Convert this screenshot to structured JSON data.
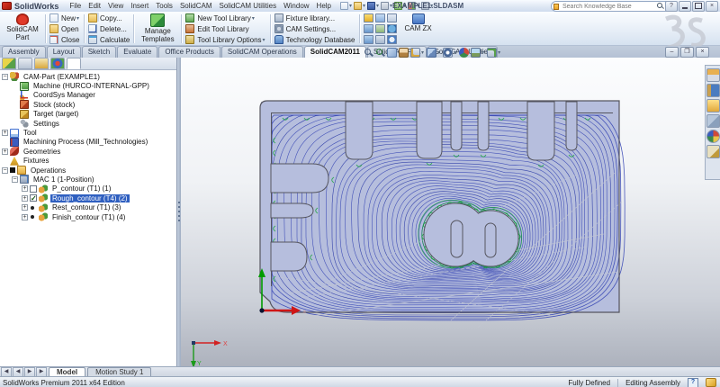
{
  "titlebar": {
    "app_name": "SolidWorks",
    "doc_title": "EXAMPLE1.SLDASM",
    "search_placeholder": "Search Knowledge Base",
    "help_label": "?",
    "menu_items": [
      "File",
      "Edit",
      "View",
      "Insert",
      "Tools",
      "SolidCAM",
      "SolidCAM Utilities",
      "Window",
      "Help"
    ],
    "quick_icons": [
      "new-doc",
      "open-doc",
      "save",
      "print",
      "undo",
      "rebuild",
      "options"
    ]
  },
  "toolbar": {
    "solidcam_part_label": "SolidCAM Part",
    "new_label": "New",
    "open_label": "Open",
    "close_label": "Close",
    "copy_label": "Copy...",
    "delete_label": "Delete...",
    "calculate_label": "Calculate",
    "manage_templates_label": "Manage Templates",
    "new_tool_library_label": "New Tool Library",
    "edit_tool_library_label": "Edit Tool Library",
    "tool_library_options_label": "Tool Library Options",
    "fixture_library_label": "Fixture library...",
    "cam_settings_label": "CAM Settings...",
    "technology_database_label": "Technology Database",
    "cam_zx_label": "CAM ZX"
  },
  "ribbon_tabs": {
    "items": [
      "Assembly",
      "Layout",
      "Sketch",
      "Evaluate",
      "Office Products",
      "SolidCAM Operations",
      "SolidCAM2011",
      "SolidCAM Part",
      "SolidCAM Utilities"
    ],
    "active": "SolidCAM2011"
  },
  "panel_tab_icons": [
    "featuremanager-tab",
    "propertymanager-tab",
    "configurationmanager-tab",
    "appearances-tab",
    "solidcam-manager-tab"
  ],
  "tree": {
    "items": [
      {
        "depth": 0,
        "icon": "campart",
        "label": "CAM-Part (EXAMPLE1)",
        "exp": "minus"
      },
      {
        "depth": 1,
        "icon": "machine",
        "label": "Machine (HURCO-INTERNAL-GPP)"
      },
      {
        "depth": 1,
        "icon": "coordsys",
        "label": "CoordSys Manager"
      },
      {
        "depth": 1,
        "icon": "stock",
        "label": "Stock (stock)"
      },
      {
        "depth": 1,
        "icon": "target",
        "label": "Target (target)"
      },
      {
        "depth": 1,
        "icon": "settings",
        "label": "Settings"
      },
      {
        "depth": 0,
        "icon": "tool",
        "label": "Tool",
        "exp": "plus"
      },
      {
        "depth": 0,
        "icon": "process",
        "label": "Machining Process (Mill_Technologies)"
      },
      {
        "depth": 0,
        "icon": "geometries",
        "label": "Geometries",
        "exp": "plus"
      },
      {
        "depth": 0,
        "icon": "fixtures",
        "label": "Fixtures"
      },
      {
        "depth": 0,
        "icon": "operations",
        "label": "Operations",
        "exp": "minus",
        "square": true
      },
      {
        "depth": 1,
        "icon": "mac",
        "label": "MAC 1 (1-Position)",
        "exp": "minus"
      },
      {
        "depth": 2,
        "icon": "op",
        "label": "P_contour (T1) (1)",
        "exp": "plus",
        "mark": "box"
      },
      {
        "depth": 2,
        "icon": "op",
        "label": "Rough_contour (T4) (2)",
        "exp": "plus",
        "mark": "check",
        "selected": true
      },
      {
        "depth": 2,
        "icon": "op",
        "label": "Rest_contour (T1) (3)",
        "exp": "plus",
        "mark": "dot"
      },
      {
        "depth": 2,
        "icon": "op",
        "label": "Finish_contour (T1) (4)",
        "exp": "plus",
        "mark": "dot"
      }
    ]
  },
  "hud_icons": [
    {
      "name": "zoom-fit",
      "caret": false
    },
    {
      "name": "zoom-area",
      "caret": false
    },
    {
      "name": "previous-view",
      "caret": false
    },
    {
      "name": "section-view",
      "caret": false
    },
    {
      "name": "view-orientation",
      "caret": true
    },
    {
      "name": "display-style",
      "caret": true
    },
    {
      "name": "hide-show",
      "caret": true
    },
    {
      "name": "edit-appearance",
      "caret": false
    },
    {
      "name": "scene",
      "caret": true
    },
    {
      "name": "view-settings",
      "caret": true
    }
  ],
  "taskpane_icons": [
    "home",
    "library",
    "folder",
    "palette",
    "appearance",
    "props"
  ],
  "doc_tabs": {
    "model_label": "Model",
    "motion_label": "Motion Study 1"
  },
  "statusbar": {
    "edition": "SolidWorks Premium 2011 x64 Edition",
    "defined_state": "Fully Defined",
    "mode": "Editing Assembly"
  },
  "viewport": {
    "x_axis_label": "X",
    "y_axis_label": "Y"
  },
  "colors": {
    "selection_blue": "#2f5fc0",
    "part_fill": "#b6bedd",
    "part_outline": "#55555f",
    "toolpath_blue": "#3d4cb6",
    "toolpath_blue_dark": "#2e3da8",
    "toolpath_green": "#17a33c",
    "rapid_gray": "#c3c7d2"
  }
}
